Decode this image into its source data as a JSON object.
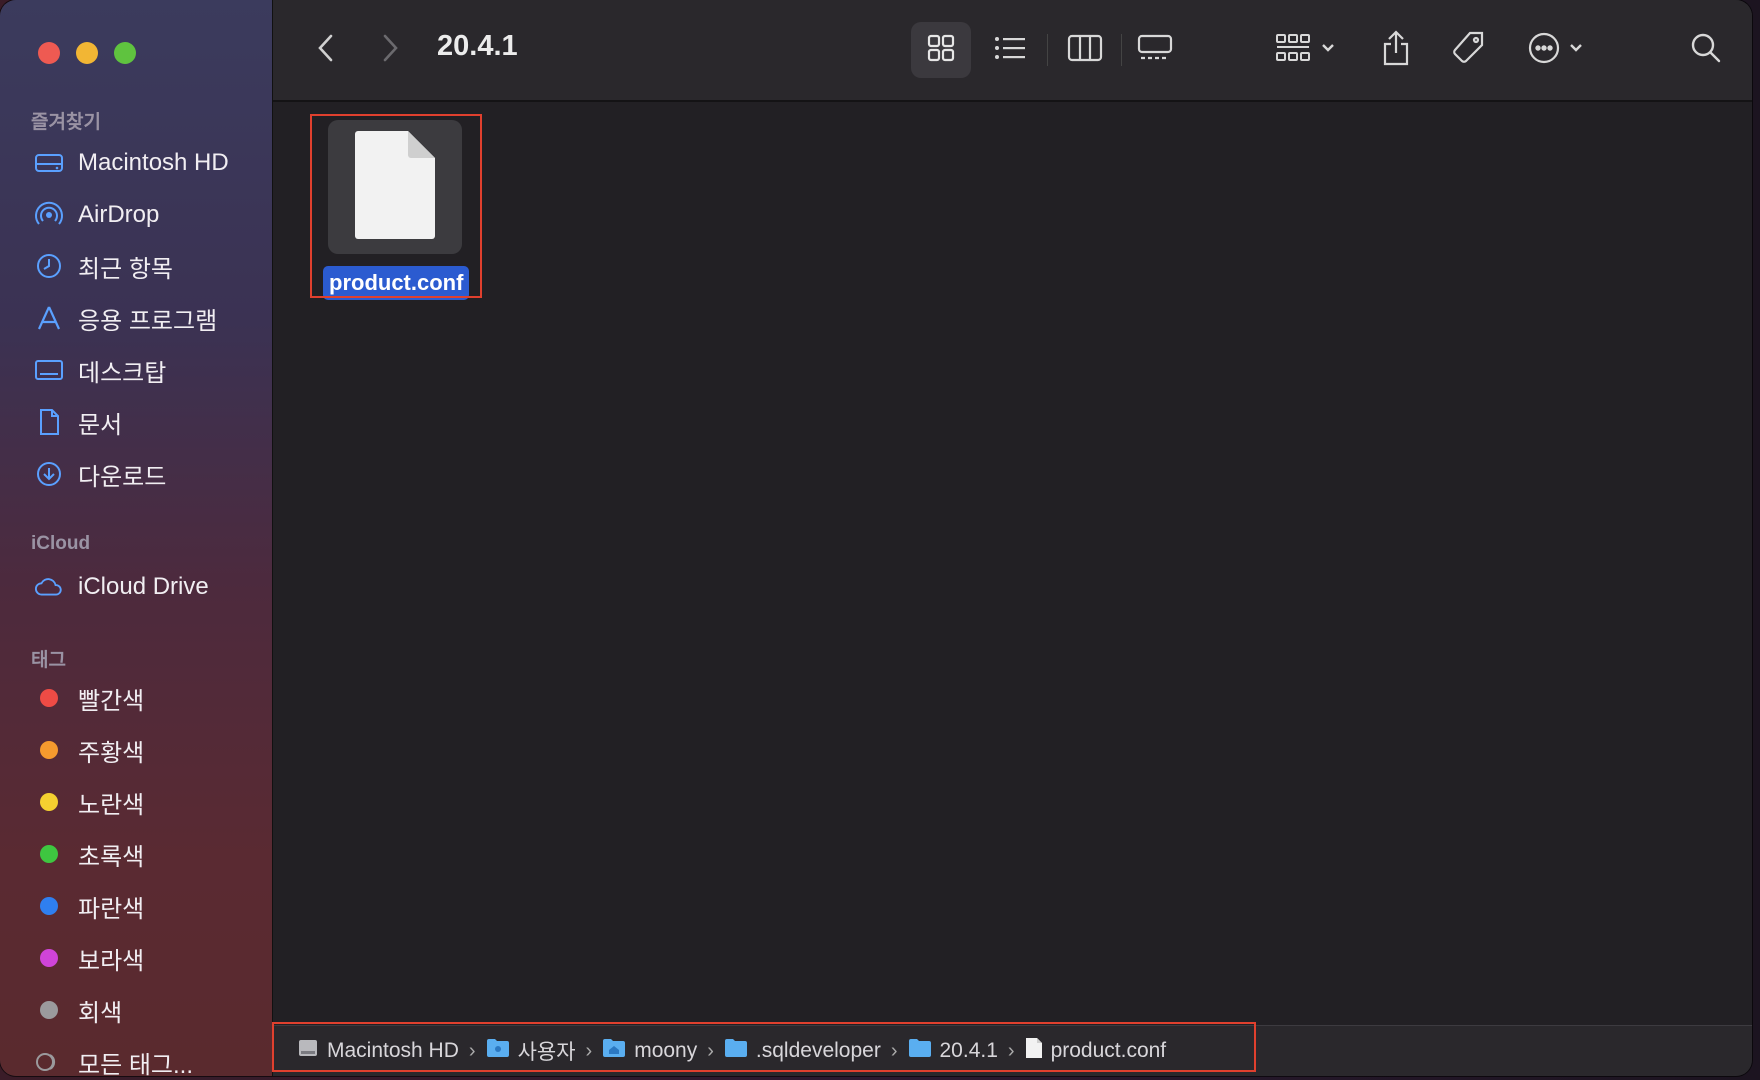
{
  "window": {
    "title": "20.4.1"
  },
  "sidebar": {
    "favorites_header": "즐겨찾기",
    "favorites": [
      {
        "label": "Macintosh HD",
        "icon": "hard-drive-icon"
      },
      {
        "label": "AirDrop",
        "icon": "airdrop-icon"
      },
      {
        "label": "최근 항목",
        "icon": "clock-icon"
      },
      {
        "label": "응용 프로그램",
        "icon": "applications-icon"
      },
      {
        "label": "데스크탑",
        "icon": "desktop-icon"
      },
      {
        "label": "문서",
        "icon": "document-icon"
      },
      {
        "label": "다운로드",
        "icon": "download-icon"
      }
    ],
    "icloud_header": "iCloud",
    "icloud": [
      {
        "label": "iCloud Drive",
        "icon": "cloud-icon"
      }
    ],
    "tags_header": "태그",
    "tags": [
      {
        "label": "빨간색",
        "color": "#ee4b45"
      },
      {
        "label": "주황색",
        "color": "#f59a2e"
      },
      {
        "label": "노란색",
        "color": "#f5d030"
      },
      {
        "label": "초록색",
        "color": "#3ec640"
      },
      {
        "label": "파란색",
        "color": "#2f7ff0"
      },
      {
        "label": "보라색",
        "color": "#d044d8"
      },
      {
        "label": "회색",
        "color": "#9b9a9d"
      },
      {
        "label": "모든 태그...",
        "color": "all-tags-icon"
      }
    ]
  },
  "toolbar": {
    "icons": [
      "back-icon",
      "forward-icon",
      "icon-view-icon",
      "list-view-icon",
      "column-view-icon",
      "gallery-view-icon",
      "group-icon",
      "share-icon",
      "tag-icon",
      "more-icon",
      "search-icon"
    ]
  },
  "files": [
    {
      "name": "product.conf",
      "selected": true
    }
  ],
  "pathbar": {
    "crumbs": [
      {
        "label": "Macintosh HD",
        "icon": "hard-drive-icon"
      },
      {
        "label": "사용자",
        "icon": "folder-icon"
      },
      {
        "label": "moony",
        "icon": "home-folder-icon"
      },
      {
        "label": ".sqldeveloper",
        "icon": "folder-icon"
      },
      {
        "label": "20.4.1",
        "icon": "folder-icon"
      },
      {
        "label": "product.conf",
        "icon": "file-icon"
      }
    ]
  },
  "colors": {
    "accent": "#2b5bd0",
    "highlight": "#e0402e"
  }
}
